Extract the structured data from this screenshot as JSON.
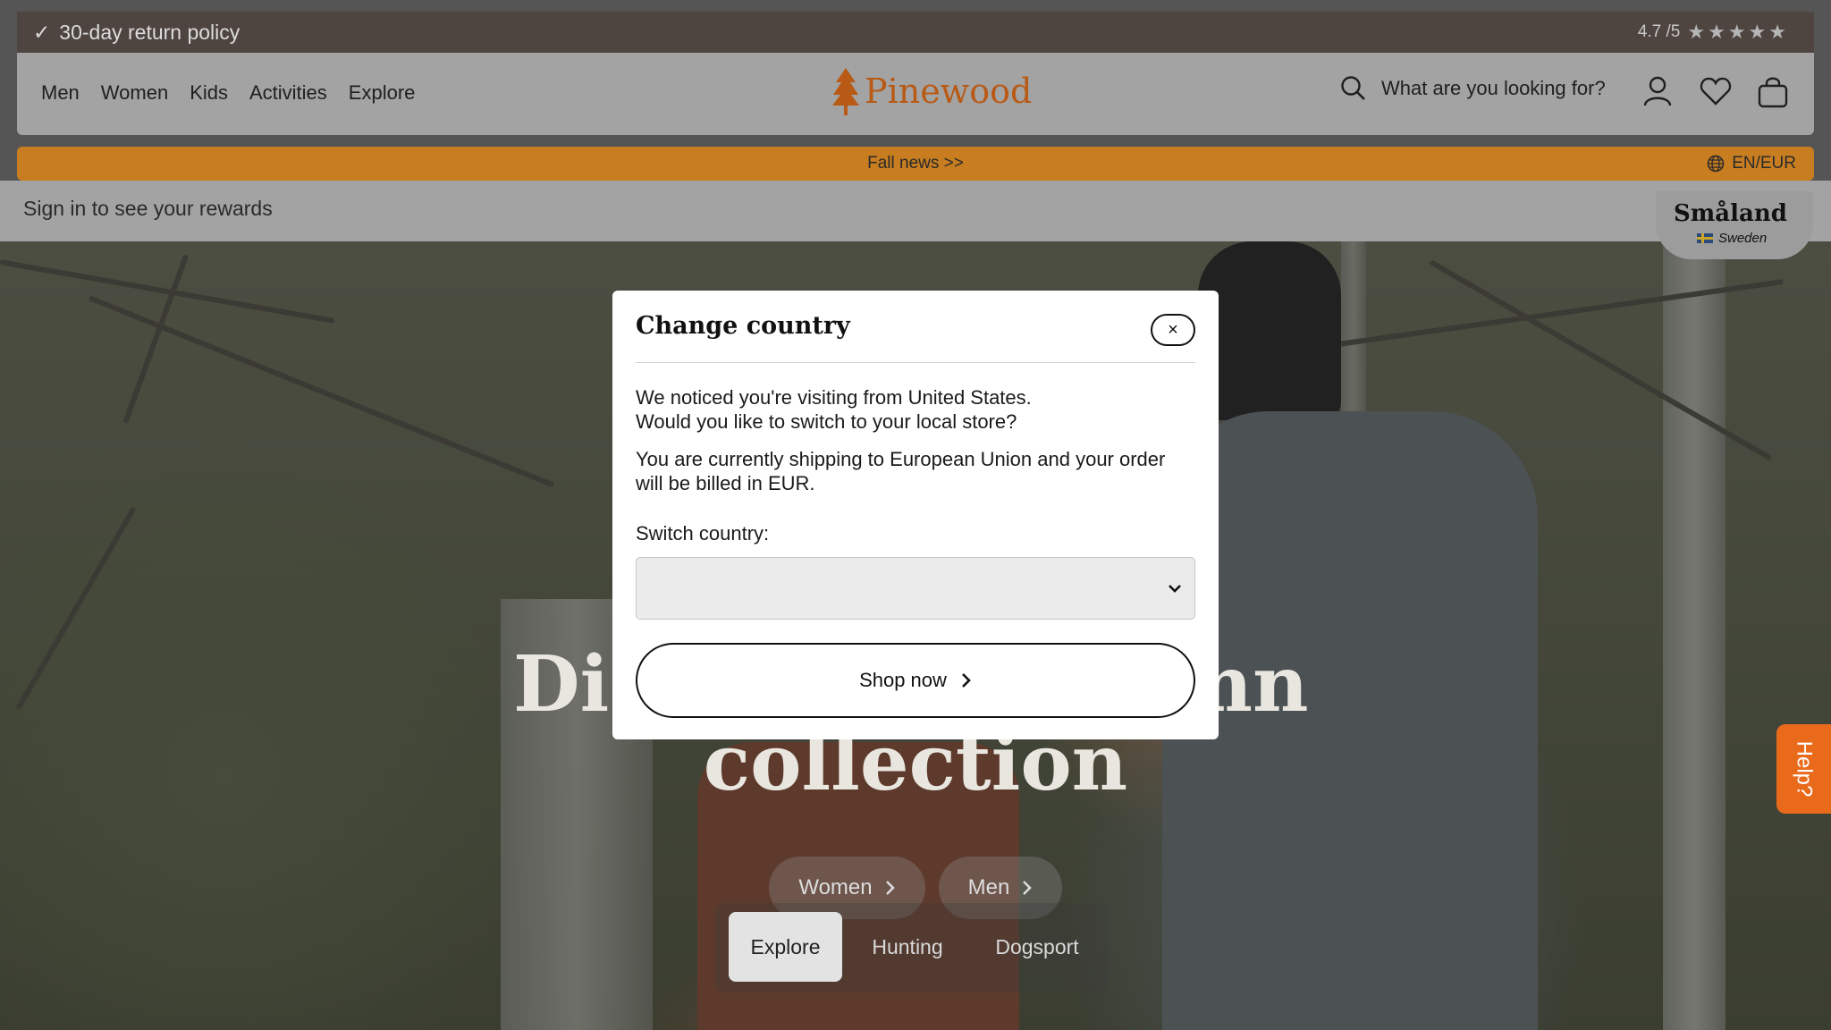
{
  "topbar": {
    "policy": "30-day return policy",
    "rating": "4.7 /5",
    "stars": "★★★★★"
  },
  "nav": {
    "links": [
      "Men",
      "Women",
      "Kids",
      "Activities",
      "Explore"
    ],
    "brand": "Pinewood",
    "search_placeholder": "What are you looking for?"
  },
  "promo": {
    "text": "Fall news >>",
    "locale": "EN/EUR"
  },
  "rewards": {
    "text": "Sign in to see your rewards"
  },
  "badge": {
    "name": "Småland",
    "country": "Sweden"
  },
  "hero": {
    "title_line1": "Dis",
    "title_line1_end": "mn",
    "title_line2": "collection",
    "pills": [
      "Women",
      "Men"
    ],
    "tabs": [
      "Explore",
      "Hunting",
      "Dogsport"
    ],
    "active_tab": "Explore"
  },
  "help": {
    "label": "Help?"
  },
  "modal": {
    "title": "Change country",
    "close": "×",
    "line1": "We noticed you're visiting from United States.",
    "line2": "Would you like to switch to your local store?",
    "line3": "You are currently shipping to European Union and your order",
    "line4": "will be billed in EUR.",
    "switch_label": "Switch country:",
    "select_value": "",
    "shop_now": "Shop now"
  },
  "colors": {
    "topbar": "#4e4440",
    "promo": "#c77d20",
    "brand": "#b85a15",
    "help": "#ea6a1c"
  }
}
